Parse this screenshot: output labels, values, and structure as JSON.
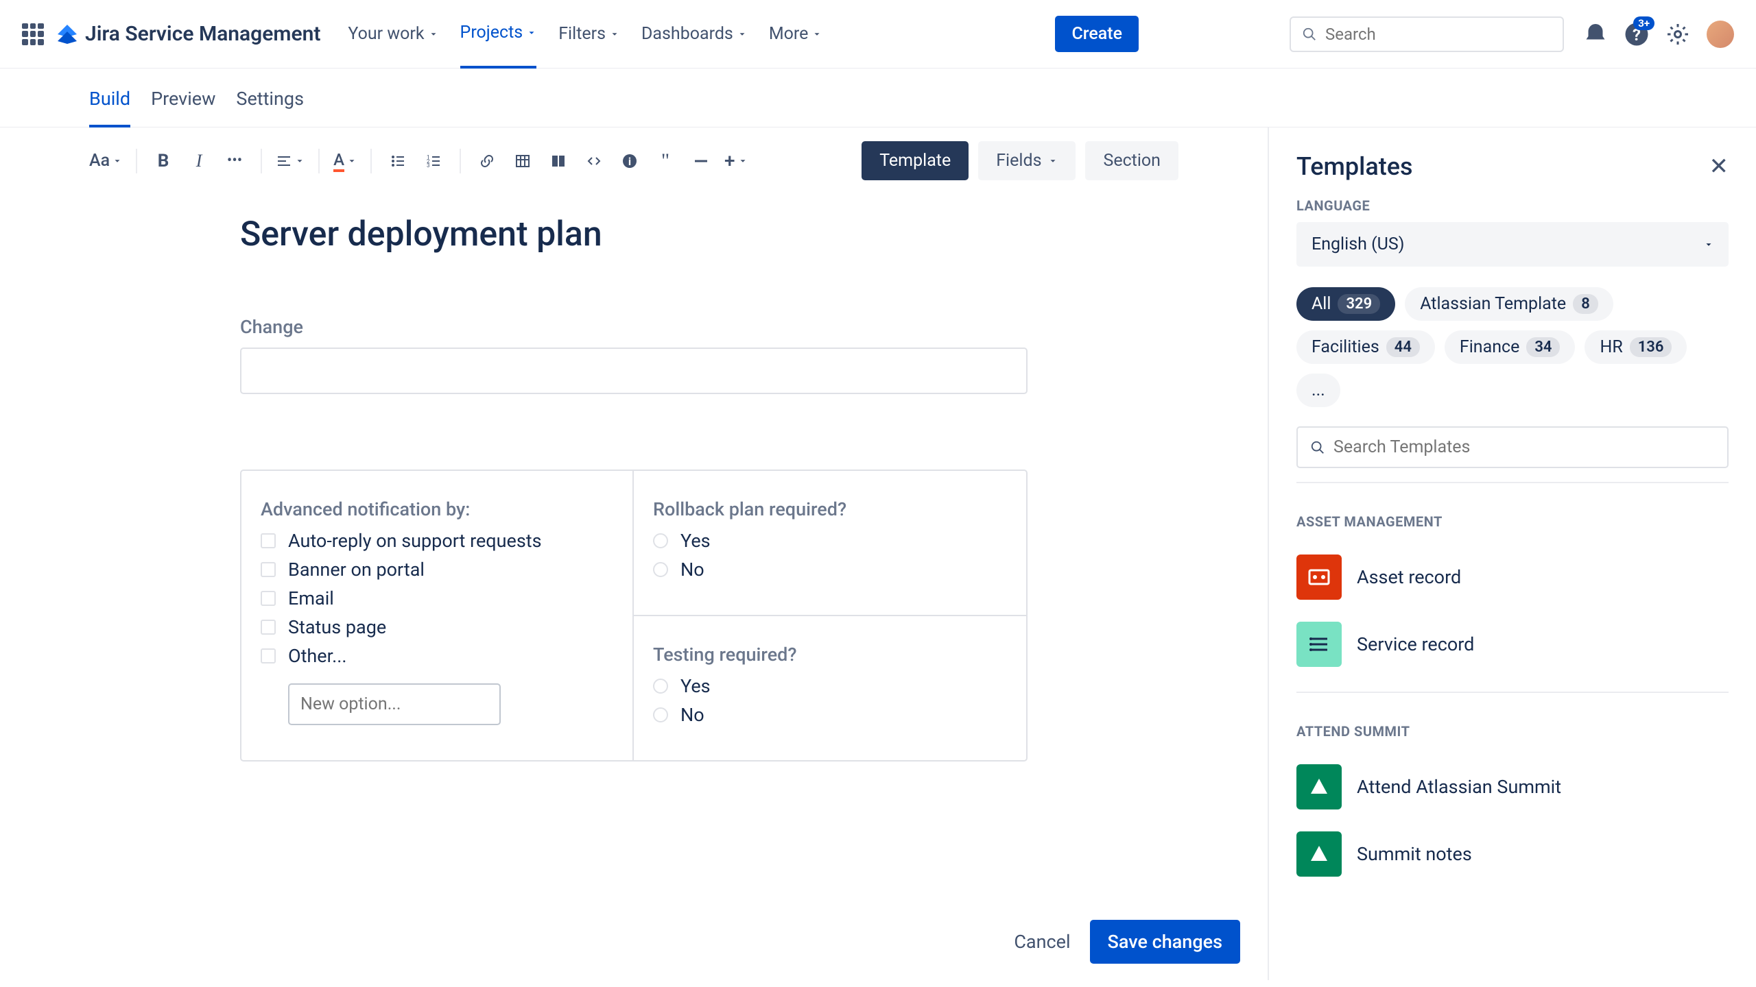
{
  "topbar": {
    "product": "Jira Service Management",
    "nav": [
      {
        "label": "Your work"
      },
      {
        "label": "Projects"
      },
      {
        "label": "Filters"
      },
      {
        "label": "Dashboards"
      },
      {
        "label": "More"
      }
    ],
    "create": "Create",
    "search_placeholder": "Search",
    "help_badge": "3+"
  },
  "subtabs": [
    "Build",
    "Preview",
    "Settings"
  ],
  "toolbar": {
    "template": "Template",
    "fields": "Fields",
    "section": "Section"
  },
  "doc": {
    "title": "Server deployment plan",
    "change_label": "Change",
    "advanced_label": "Advanced notification by:",
    "advanced_options": [
      "Auto-reply on support requests",
      "Banner on portal",
      "Email",
      "Status page",
      "Other..."
    ],
    "new_option_placeholder": "New option...",
    "rollback_label": "Rollback plan required?",
    "rollback_options": [
      "Yes",
      "No"
    ],
    "testing_label": "Testing required?",
    "testing_options": [
      "Yes",
      "No"
    ]
  },
  "footer": {
    "cancel": "Cancel",
    "save": "Save changes"
  },
  "sidepanel": {
    "title": "Templates",
    "language_label": "LANGUAGE",
    "language_value": "English (US)",
    "chips": [
      {
        "label": "All",
        "count": "329"
      },
      {
        "label": "Atlassian Template",
        "count": "8"
      },
      {
        "label": "Facilities",
        "count": "44"
      },
      {
        "label": "Finance",
        "count": "34"
      },
      {
        "label": "HR",
        "count": "136"
      }
    ],
    "more": "...",
    "search_placeholder": "Search Templates",
    "sections": [
      {
        "head": "ASSET MANAGEMENT",
        "items": [
          {
            "name": "Asset record",
            "color": "red",
            "glyph": "asset"
          },
          {
            "name": "Service record",
            "color": "mint",
            "glyph": "service"
          }
        ]
      },
      {
        "head": "ATTEND SUMMIT",
        "items": [
          {
            "name": "Attend Atlassian Summit",
            "color": "green",
            "glyph": "summit"
          },
          {
            "name": "Summit notes",
            "color": "green",
            "glyph": "summit"
          }
        ]
      }
    ]
  }
}
